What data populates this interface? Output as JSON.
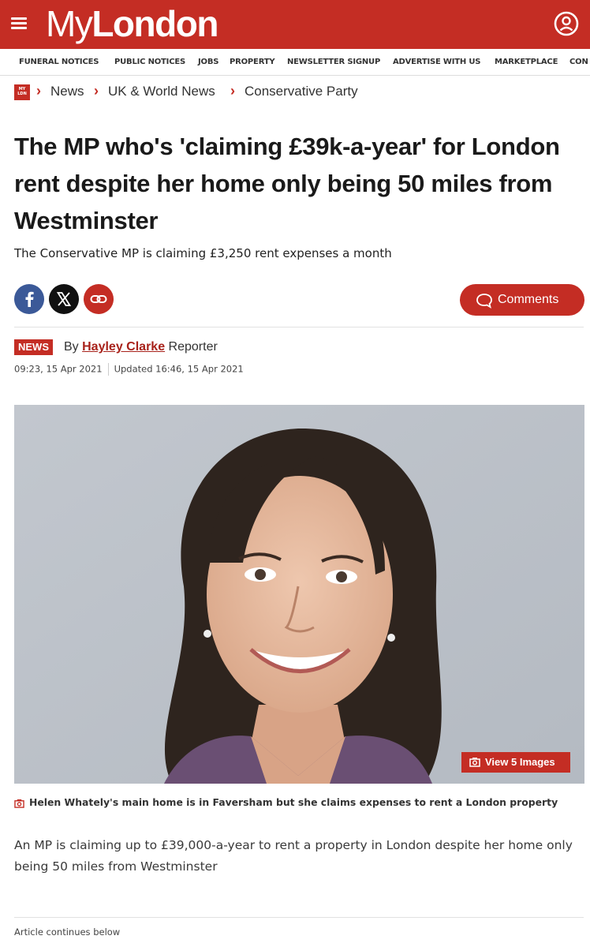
{
  "header": {
    "logo_my": "My",
    "logo_london": "London",
    "nav": [
      "FUNERAL NOTICES",
      "PUBLIC NOTICES",
      "JOBS",
      "PROPERTY",
      "NEWSLETTER SIGNUP",
      "ADVERTISE WITH US",
      "MARKETPLACE",
      "CON"
    ]
  },
  "breadcrumb": {
    "items": [
      "News",
      "UK & World News",
      "Conservative Party"
    ]
  },
  "article": {
    "headline": "The MP who's 'claiming £39k-a-year' for London rent despite her home only being 50 miles from Westminster",
    "subheading": "The Conservative MP is claiming £3,250 rent expenses a month",
    "comments_label": "Comments",
    "badge": "NEWS",
    "by_prefix": "By",
    "author": "Hayley Clarke",
    "role": "Reporter",
    "published": "09:23, 15 Apr 2021",
    "updated": "Updated 16:46, 15 Apr 2021",
    "view_images_label": "View 5 Images",
    "caption": "Helen Whately's main home is in Faversham but she claims expenses to rent a London property",
    "body": "An MP is claiming up to £39,000-a-year to rent a property in London despite her home only being 50 miles from Westminster",
    "continues_label": "Article continues below"
  },
  "colors": {
    "brand_red": "#c42d24",
    "facebook_blue": "#3b5998",
    "x_black": "#111111"
  },
  "icons": {
    "menu": "hamburger-menu-icon",
    "account": "user-account-icon",
    "facebook": "facebook-icon",
    "x": "x-icon",
    "link": "link-icon",
    "comment": "speech-bubble-icon",
    "gallery": "camera-icon"
  }
}
